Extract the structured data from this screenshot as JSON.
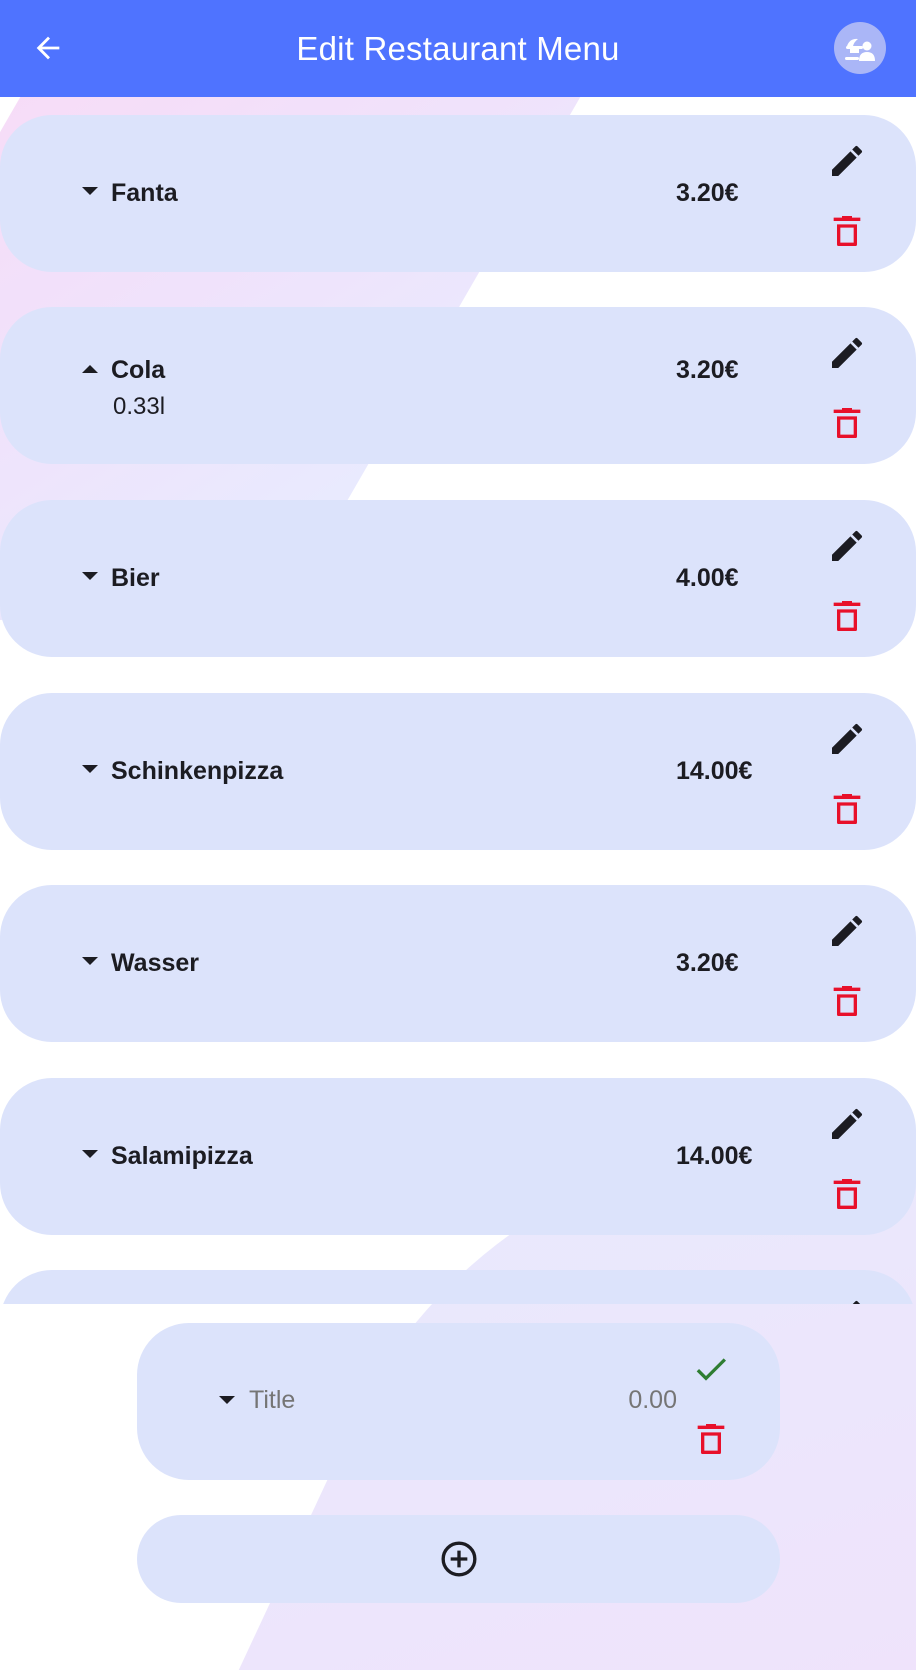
{
  "app_bar": {
    "title": "Edit Restaurant Menu",
    "back_icon": "arrow-left-icon",
    "avatar_icon": "restaurant-waiter-icon",
    "color": "#4f73ff"
  },
  "menu_items": [
    {
      "name": "Fanta",
      "price": "3.20€",
      "expanded": false,
      "description": ""
    },
    {
      "name": "Cola",
      "price": "3.20€",
      "expanded": true,
      "description": "0.33l"
    },
    {
      "name": "Bier",
      "price": "4.00€",
      "expanded": false,
      "description": ""
    },
    {
      "name": "Schinkenpizza",
      "price": "14.00€",
      "expanded": false,
      "description": ""
    },
    {
      "name": "Wasser",
      "price": "3.20€",
      "expanded": false,
      "description": ""
    },
    {
      "name": "Salamipizza",
      "price": "14.00€",
      "expanded": false,
      "description": ""
    }
  ],
  "new_item": {
    "title_placeholder": "Title",
    "price_placeholder": "0.00",
    "confirm_icon": "check-icon",
    "delete_icon": "trash-icon"
  },
  "add_button": {
    "icon": "add-circle-icon"
  },
  "colors": {
    "card": "#dce3fb",
    "edit_icon": "#1c1c22",
    "delete_icon": "#e8102a",
    "confirm_icon": "#2e7d32"
  }
}
